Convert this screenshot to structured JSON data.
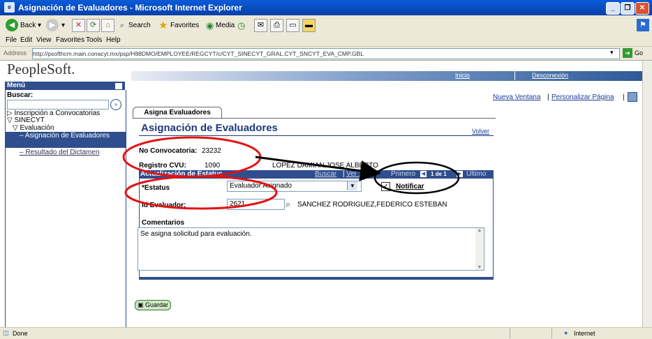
{
  "window": {
    "title": "Asignación de Evaluadores - Microsoft Internet Explorer"
  },
  "toolbar": {
    "back": "Back",
    "search": "Search",
    "favorites": "Favorites",
    "media": "Media"
  },
  "menubar": {
    "items": [
      "File",
      "Edit",
      "View",
      "Favorites",
      "Tools",
      "Help"
    ]
  },
  "address": {
    "label": "Address",
    "url": "http://psofthcm.main.conacyt.mx/psp/H88DMO/EMPLOYEE/REGCYT/c/CYT_SINECYT_GRAL.CYT_SNCYT_EVA_CMP.GBL",
    "go": "Go"
  },
  "banner": {
    "logo": "PeopleSoft.",
    "inicio": "Inicio",
    "desconexion": "Desconexión"
  },
  "menu": {
    "title": "Menú",
    "search_label": "Buscar:",
    "items": [
      "Inscripción a Convocatorias",
      "SINECYT",
      "Evaluación",
      "– Asignación de Evaluadores",
      "– Resultado del Dictamen"
    ]
  },
  "content": {
    "nueva_ventana": "Nueva Ventana",
    "personalizar": "Personalizar Página",
    "tab": "Asigna Evaluadores",
    "heading": "Asignación de Evaluadores",
    "volver": "Volver",
    "no_convocatoria_label": "No Convocatoria:",
    "no_convocatoria_value": "23232",
    "registro_cvu_label": "Registro CVU:",
    "registro_cvu_value": "1090",
    "persona": "LOPEZ DAMIAN,JOSE ALBERTO",
    "grid_title": "Actualización de Estatus",
    "buscar": "Buscar",
    "ver": "Ver 1",
    "primero": "Primero",
    "pager": "1 de 1",
    "ultimo": "Último",
    "estatus_label": "*Estatus",
    "estatus_value": "Evaluador Asignado",
    "notificar": "Notificar",
    "id_evaluador_label": "Id Evaluador:",
    "id_evaluador_value": "2621",
    "evaluador_nombre": "SANCHEZ RODRIGUEZ,FEDERICO ESTEBAN",
    "comentarios_label": "Comentarios",
    "comentarios_value": "Se asigna solicitud para evaluación.",
    "guardar": "Guardar"
  },
  "status": {
    "left": "Done",
    "zone": "Internet"
  },
  "colors": {
    "ie_blue": "#0840a8",
    "ps_blue": "#2f4e8e",
    "annotation": "#e41111"
  }
}
